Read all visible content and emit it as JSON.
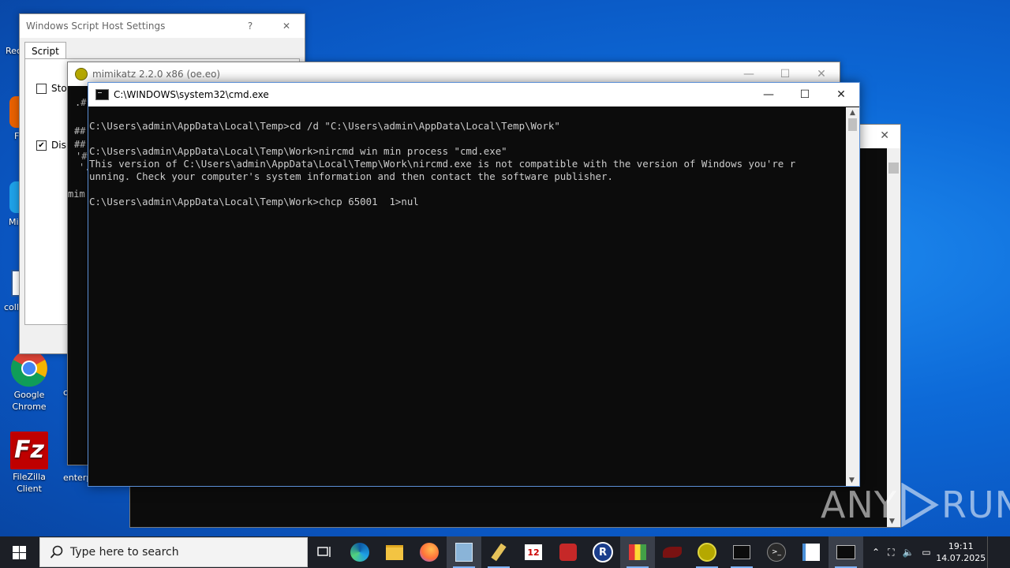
{
  "desktop": {
    "icons": [
      {
        "label": "Google Chrome"
      },
      {
        "label": "FileZilla Client"
      }
    ],
    "partial_labels": [
      "Rec",
      "F",
      "Mi",
      "coll",
      "c",
      "enterp"
    ]
  },
  "wsh_window": {
    "title": "Windows Script Host Settings",
    "help": "?",
    "close": "✕",
    "tab": "Script",
    "checkbox1_label": "Stop",
    "checkbox2_label": "Disp"
  },
  "mimikatz_window": {
    "title": "mimikatz 2.2.0 x86 (oe.eo)",
    "fragments": [
      ".#",
      "##",
      "##",
      "'#",
      "'.",
      "mim"
    ]
  },
  "cmd_window": {
    "title": "C:\\WINDOWS\\system32\\cmd.exe",
    "console_text": "C:\\Users\\admin\\AppData\\Local\\Temp>cd /d \"C:\\Users\\admin\\AppData\\Local\\Temp\\Work\"\n\nC:\\Users\\admin\\AppData\\Local\\Temp\\Work>nircmd win min process \"cmd.exe\"\nThis version of C:\\Users\\admin\\AppData\\Local\\Temp\\Work\\nircmd.exe is not compatible with the version of Windows you're r\nunning. Check your computer's system information and then contact the software publisher.\n\nC:\\Users\\admin\\AppData\\Local\\Temp\\Work>chcp 65001  1>nul"
  },
  "taskbar": {
    "search_placeholder": "Type here to search",
    "time": "19:11",
    "date": "14.07.2025"
  },
  "watermark": {
    "left": "ANY",
    "right": "RUN"
  },
  "colors": {
    "desktop_bg": "#0a5fc9",
    "console_bg": "#0c0c0c",
    "console_fg": "#cccccc",
    "taskbar_bg": "#1c1f26"
  }
}
